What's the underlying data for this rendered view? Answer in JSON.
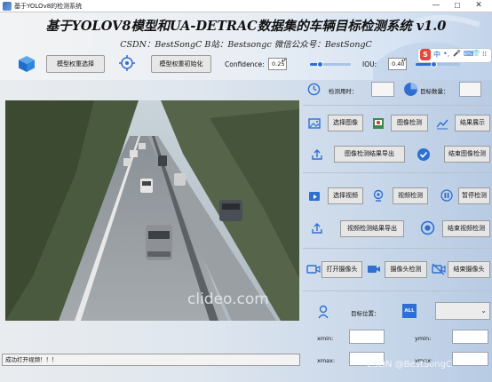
{
  "window": {
    "title": "基于YOLOv8的检测系统",
    "controls": {
      "minimize": "—",
      "maximize": "☐",
      "close": "✕"
    }
  },
  "header": {
    "title": "基于YOLOV8模型和UA-DETRAC数据集的车辆目标检测系统 v1.0",
    "subtitle": "CSDN：BestSongC   B站：Bestsongc   微信公众号：BestSongC"
  },
  "toolbar": {
    "select_weights_label": "模型权重选择",
    "init_weights_label": "模型权重初始化",
    "confidence_label": "Confidence:",
    "confidence_value": "0.25",
    "confidence_fraction": 0.25,
    "iou_label": "IOU:",
    "iou_value": "0.40",
    "iou_fraction": 0.4
  },
  "ime": {
    "logo": "S",
    "lang": "中",
    "punct": "•,",
    "mic": "🎤",
    "kbd": "⌨",
    "skin": "👕",
    "grid": "⁞⁞"
  },
  "video": {
    "watermark": "clideo.com"
  },
  "status_bar": {
    "message": "成功打开视频！！！"
  },
  "right_panel": {
    "timer_label": "检测用时：",
    "count_label": "目标数量：",
    "image": {
      "select_label": "选择图像",
      "detect_label": "图像检测",
      "show_result_label": "结果展示",
      "export_label": "图像检测结果导出",
      "finish_label": "结束图像检测"
    },
    "video": {
      "select_label": "选择视频",
      "detect_label": "视频检测",
      "pause_label": "暂停检测",
      "export_label": "视频检测结果导出",
      "finish_label": "结束视频检测"
    },
    "camera": {
      "open_label": "打开摄像头",
      "detect_label": "摄像头检测",
      "finish_label": "结束摄像头"
    },
    "target": {
      "position_label": "目标位置：",
      "all_badge": "ALL",
      "xmin_label": "xmin:",
      "ymin_label": "ymin:",
      "xmax_label": "xmax:",
      "ymax_label": "ymax:"
    }
  },
  "overlay_watermark": "CSDN @BestSongC"
}
